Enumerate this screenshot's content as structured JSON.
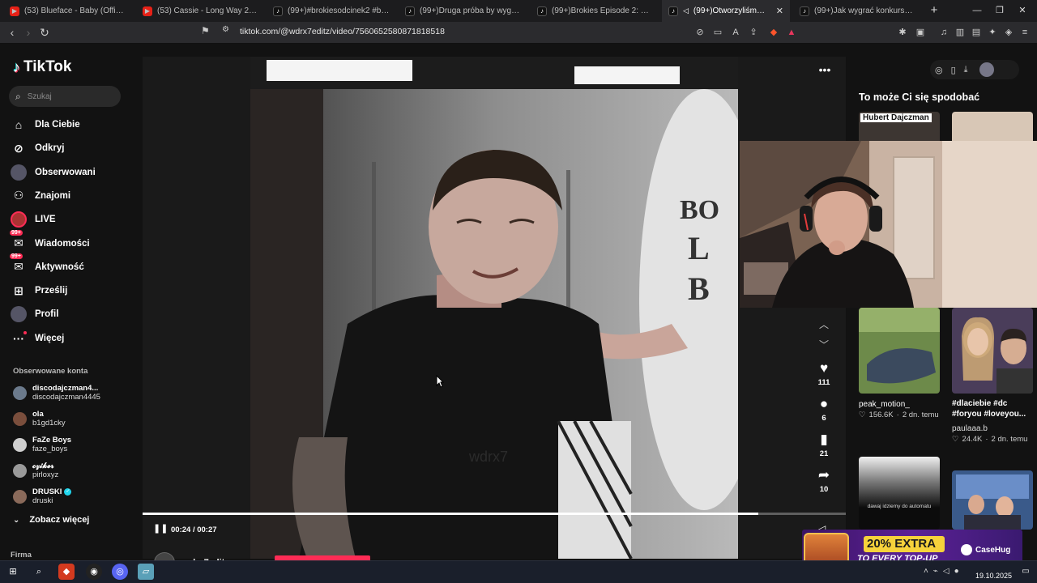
{
  "browser": {
    "tabs": [
      {
        "title": "(53) Blueface - Baby (Official Music V",
        "favicon": "youtube",
        "active": false
      },
      {
        "title": "(53) Cassie - Long Way 2 Go (Officia",
        "favicon": "youtube",
        "active": false
      },
      {
        "title": "(99+)#brokiesodcinek2 #brokies | Tik",
        "favicon": "tiktok",
        "active": false
      },
      {
        "title": "(99+)Druga próba by wygrać koszul",
        "favicon": "tiktok",
        "active": false
      },
      {
        "title": "(99+)Brokies Episode 2: Exploring Re",
        "favicon": "tiktok",
        "active": false
      },
      {
        "title": "(99+)Otworzyliśmy salon fryz",
        "favicon": "tiktok",
        "active": true
      },
      {
        "title": "(99+)Jak wygrać konkurs? Porady i s",
        "favicon": "tiktok",
        "active": false
      }
    ],
    "url": "tiktok.com/@wdrx7editz/video/7560652580871818518"
  },
  "tiktok": {
    "logo_text": "TikTok",
    "search_placeholder": "Szukaj",
    "nav": [
      {
        "label": "Dla Ciebie",
        "icon": "home-icon"
      },
      {
        "label": "Odkryj",
        "icon": "compass-icon"
      },
      {
        "label": "Obserwowani",
        "icon": "following-avatar-icon"
      },
      {
        "label": "Znajomi",
        "icon": "friends-icon"
      },
      {
        "label": "LIVE",
        "icon": "live-icon"
      },
      {
        "label": "Wiadomości",
        "icon": "messages-icon",
        "badge": "99+"
      },
      {
        "label": "Aktywność",
        "icon": "activity-icon",
        "badge": "99+"
      },
      {
        "label": "Prześlij",
        "icon": "upload-icon"
      },
      {
        "label": "Profil",
        "icon": "profile-icon"
      },
      {
        "label": "Więcej",
        "icon": "more-icon"
      }
    ],
    "followed_title": "Obserwowane konta",
    "followed": [
      {
        "name": "discodajczman4...",
        "handle": "discodajczman4445",
        "verified": false
      },
      {
        "name": "ola",
        "handle": "b1gd1cky",
        "verified": false
      },
      {
        "name": "FaZe Boys",
        "handle": "faze_boys",
        "verified": false
      },
      {
        "name": "𝓬𝔃𝓲𝓴𝓮𝓻",
        "handle": "pirloxyz",
        "verified": false
      },
      {
        "name": "DRUSKI",
        "handle": "druski",
        "verified": true
      }
    ],
    "see_more": "Zobacz więcej",
    "company": "Firma"
  },
  "video": {
    "watermark": "wdrx7",
    "current_time": "00:24",
    "duration": "00:27",
    "progress": 0.876,
    "likes": "111",
    "comments": "6",
    "saves": "21",
    "shares": "10",
    "author": "wdrx7editz"
  },
  "recommendations": {
    "title": "To może Ci się spodobać",
    "items": [
      {
        "label": "Hubert Dajczman"
      },
      {
        "caption": "peak_motion_",
        "likes": "156.6K",
        "age": "2 dn. temu"
      },
      {
        "caption": "#dlaciebie #dc #foryou #loveyou...",
        "author": "paulaaa.b",
        "likes": "24.4K",
        "age": "2 dn. temu"
      },
      {
        "overlay_text": "dawaj idziemy do automatu"
      }
    ]
  },
  "ad": {
    "headline": "20% EXTRA",
    "subline": "TO EVERY TOP-UP",
    "brand": "CaseHug"
  },
  "taskbar": {
    "date": "19.10.2025"
  },
  "colors": {
    "accent": "#fe2c55",
    "cyan": "#25f4ee",
    "background": "#121212"
  }
}
